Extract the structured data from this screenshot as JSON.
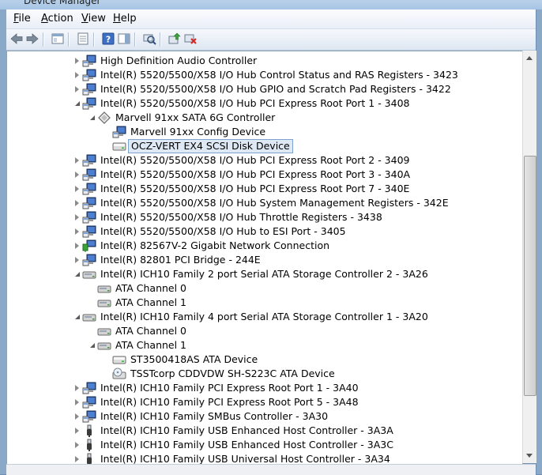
{
  "window": {
    "title": "Device Manager"
  },
  "menu": [
    {
      "pre": "",
      "accel": "F",
      "post": "ile"
    },
    {
      "pre": "",
      "accel": "A",
      "post": "ction"
    },
    {
      "pre": "",
      "accel": "V",
      "post": "iew"
    },
    {
      "pre": "",
      "accel": "H",
      "post": "elp"
    }
  ],
  "toolbar": [
    {
      "name": "back-arrow-icon"
    },
    {
      "name": "forward-arrow-icon"
    },
    {
      "name": "show-hide-console-tree-icon"
    },
    {
      "name": "properties-icon"
    },
    {
      "name": "help-icon"
    },
    {
      "name": "show-hide-action-pane-icon"
    },
    {
      "name": "scan-hardware-changes-icon"
    },
    {
      "name": "update-driver-icon"
    },
    {
      "name": "uninstall-device-icon"
    }
  ],
  "tree": [
    {
      "level": 0,
      "expander": "collapsed",
      "icon": "monitor",
      "label": "High Definition Audio Controller"
    },
    {
      "level": 0,
      "expander": "collapsed",
      "icon": "monitor",
      "label": "Intel(R) 5520/5500/X58 I/O Hub Control Status and RAS Registers - 3423"
    },
    {
      "level": 0,
      "expander": "collapsed",
      "icon": "monitor",
      "label": "Intel(R) 5520/5500/X58 I/O Hub GPIO and Scratch Pad Registers - 3422"
    },
    {
      "level": 0,
      "expander": "expanded",
      "icon": "monitor",
      "label": "Intel(R) 5520/5500/X58 I/O Hub PCI Express Root Port 1 - 3408"
    },
    {
      "level": 1,
      "expander": "expanded",
      "icon": "diamond",
      "label": "Marvell 91xx SATA 6G Controller"
    },
    {
      "level": 2,
      "expander": "none",
      "icon": "monitor",
      "label": "Marvell 91xx Config Device"
    },
    {
      "level": 2,
      "expander": "none",
      "icon": "disk",
      "label": "OCZ-VERT EX4 SCSI Disk Device",
      "selected": true
    },
    {
      "level": 0,
      "expander": "collapsed",
      "icon": "monitor",
      "label": "Intel(R) 5520/5500/X58 I/O Hub PCI Express Root Port 2 - 3409"
    },
    {
      "level": 0,
      "expander": "collapsed",
      "icon": "monitor",
      "label": "Intel(R) 5520/5500/X58 I/O Hub PCI Express Root Port 3 - 340A"
    },
    {
      "level": 0,
      "expander": "collapsed",
      "icon": "monitor",
      "label": "Intel(R) 5520/5500/X58 I/O Hub PCI Express Root Port 7 - 340E"
    },
    {
      "level": 0,
      "expander": "collapsed",
      "icon": "monitor",
      "label": "Intel(R) 5520/5500/X58 I/O Hub System Management Registers - 342E"
    },
    {
      "level": 0,
      "expander": "collapsed",
      "icon": "monitor",
      "label": "Intel(R) 5520/5500/X58 I/O Hub Throttle Registers - 3438"
    },
    {
      "level": 0,
      "expander": "collapsed",
      "icon": "monitor",
      "label": "Intel(R) 5520/5500/X58 I/O Hub to ESI Port - 3405"
    },
    {
      "level": 0,
      "expander": "collapsed",
      "icon": "network",
      "label": "Intel(R) 82567V-2 Gigabit Network Connection"
    },
    {
      "level": 0,
      "expander": "collapsed",
      "icon": "monitor",
      "label": "Intel(R) 82801 PCI Bridge - 244E"
    },
    {
      "level": 0,
      "expander": "expanded",
      "icon": "controller",
      "label": "Intel(R) ICH10 Family 2 port Serial ATA Storage Controller 2 - 3A26"
    },
    {
      "level": 1,
      "expander": "none",
      "icon": "controller",
      "label": "ATA Channel 0"
    },
    {
      "level": 1,
      "expander": "none",
      "icon": "controller",
      "label": "ATA Channel 1"
    },
    {
      "level": 0,
      "expander": "expanded",
      "icon": "controller",
      "label": "Intel(R) ICH10 Family 4 port Serial ATA Storage Controller 1 - 3A20"
    },
    {
      "level": 1,
      "expander": "none",
      "icon": "controller",
      "label": "ATA Channel 0"
    },
    {
      "level": 1,
      "expander": "expanded",
      "icon": "controller",
      "label": "ATA Channel 1"
    },
    {
      "level": 2,
      "expander": "none",
      "icon": "disk",
      "label": "ST3500418AS ATA Device"
    },
    {
      "level": 2,
      "expander": "none",
      "icon": "optical",
      "label": "TSSTcorp CDDVDW SH-S223C ATA Device"
    },
    {
      "level": 0,
      "expander": "collapsed",
      "icon": "monitor",
      "label": "Intel(R) ICH10 Family PCI Express Root Port 1 - 3A40"
    },
    {
      "level": 0,
      "expander": "collapsed",
      "icon": "monitor",
      "label": "Intel(R) ICH10 Family PCI Express Root Port 5 - 3A48"
    },
    {
      "level": 0,
      "expander": "collapsed",
      "icon": "monitor",
      "label": "Intel(R) ICH10 Family SMBus Controller - 3A30"
    },
    {
      "level": 0,
      "expander": "collapsed",
      "icon": "usb",
      "label": "Intel(R) ICH10 Family USB Enhanced Host Controller - 3A3A"
    },
    {
      "level": 0,
      "expander": "collapsed",
      "icon": "usb",
      "label": "Intel(R) ICH10 Family USB Enhanced Host Controller - 3A3C"
    },
    {
      "level": 0,
      "expander": "collapsed",
      "icon": "usb",
      "label": "Intel(R) ICH10 Family USB Universal Host Controller - 3A34"
    }
  ]
}
